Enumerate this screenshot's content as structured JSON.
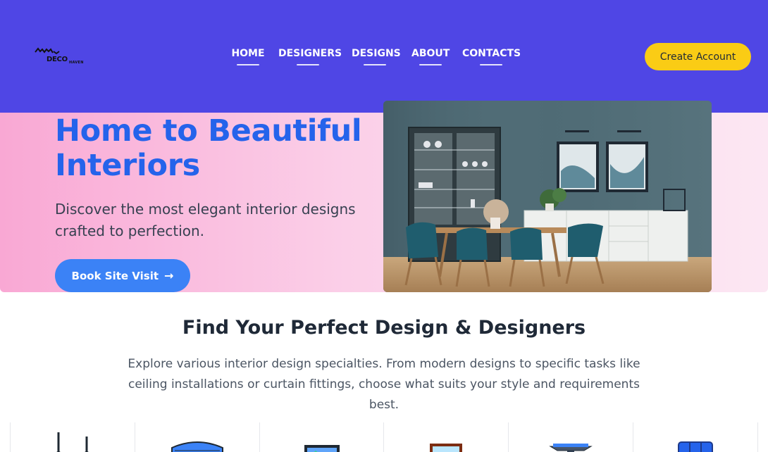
{
  "header": {
    "logo_text": "DECO",
    "logo_subtext": "HAVEN",
    "nav": [
      {
        "label": "HOME"
      },
      {
        "label": "DESIGNERS"
      },
      {
        "label": "DESIGNS"
      },
      {
        "label": "ABOUT"
      },
      {
        "label": "CONTACTS"
      }
    ],
    "create_account_label": "Create Account"
  },
  "hero": {
    "title": "Home to Beautiful Interiors",
    "subtitle": "Discover the most elegant interior designs crafted to perfection.",
    "cta_label": "Book Site Visit",
    "cta_icon": "arrow-right-icon",
    "image": "dining-room-image"
  },
  "section": {
    "title": "Find Your Perfect Design & Designers",
    "description": "Explore various interior design specialties. From modern designs to specific tasks like ceiling installations or curtain fittings, choose what suits your style and requirements best."
  },
  "categories": [
    {
      "icon": "ceiling-light-icon"
    },
    {
      "icon": "curtain-icon"
    },
    {
      "icon": "wall-art-icon"
    },
    {
      "icon": "painting-frame-icon"
    },
    {
      "icon": "lamp-icon"
    },
    {
      "icon": "wardrobe-icon"
    }
  ],
  "colors": {
    "header_bg": "#4f46e5",
    "accent_yellow": "#facc15",
    "hero_title": "#2563eb",
    "button_blue": "#3b82f6"
  }
}
